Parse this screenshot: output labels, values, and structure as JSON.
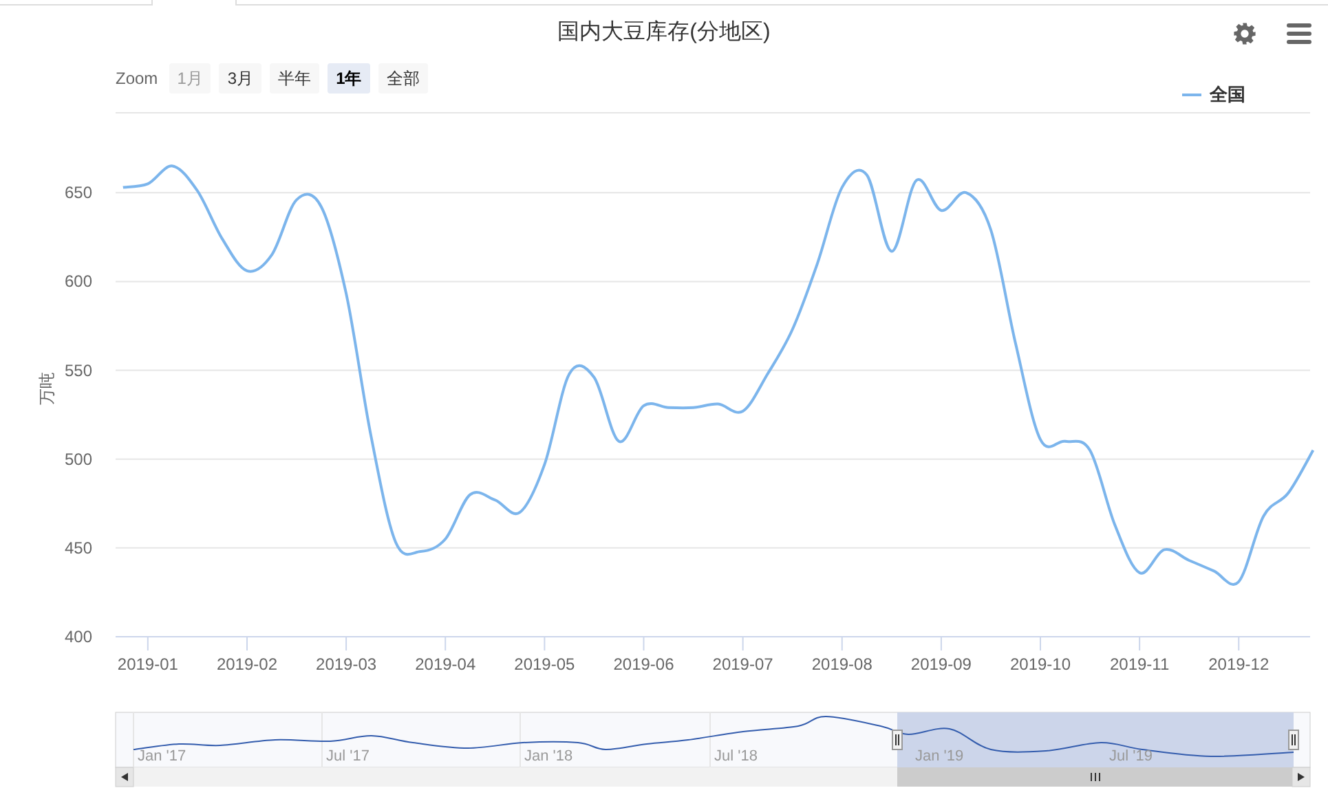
{
  "title": "国内大豆库存(分地区)",
  "toolbar": {
    "zoom_label": "Zoom",
    "range_buttons": [
      {
        "label": "1月",
        "selected": false,
        "disabled": true
      },
      {
        "label": "3月",
        "selected": false,
        "disabled": false
      },
      {
        "label": "半年",
        "selected": false,
        "disabled": false
      },
      {
        "label": "1年",
        "selected": true,
        "disabled": false
      },
      {
        "label": "全部",
        "selected": false,
        "disabled": false
      }
    ]
  },
  "chart_data": {
    "type": "line",
    "ylabel": "万吨",
    "ylim": [
      400,
      695
    ],
    "grid": true,
    "categories": [
      null,
      "2019-01",
      null,
      null,
      null,
      "2019-02",
      null,
      null,
      null,
      "2019-03",
      null,
      null,
      null,
      "2019-04",
      null,
      null,
      null,
      "2019-05",
      null,
      null,
      null,
      "2019-06",
      null,
      null,
      null,
      "2019-07",
      null,
      null,
      null,
      "2019-08",
      null,
      null,
      null,
      "2019-09",
      null,
      null,
      null,
      "2019-10",
      null,
      null,
      null,
      "2019-11",
      null,
      null,
      null,
      "2019-12",
      null,
      null,
      null
    ],
    "yticks": [
      400,
      450,
      500,
      550,
      600,
      650
    ],
    "series": [
      {
        "name": "全国",
        "color": "#7cb5ec",
        "values": [
          653,
          655,
          665,
          651,
          624,
          606,
          615,
          646,
          642,
          593,
          513,
          453,
          448,
          455,
          480,
          477,
          470,
          497,
          548,
          546,
          510,
          530,
          529,
          529,
          531,
          527,
          548,
          573,
          610,
          653,
          660,
          617,
          657,
          640,
          650,
          629,
          565,
          511,
          510,
          505,
          463,
          436,
          449,
          443,
          437,
          431,
          468,
          481,
          505
        ]
      }
    ]
  },
  "navigator": {
    "labels": [
      "Jan '17",
      "Jul '17",
      "Jan '18",
      "Jul '18",
      "Jan '19",
      "Jul '19"
    ]
  }
}
